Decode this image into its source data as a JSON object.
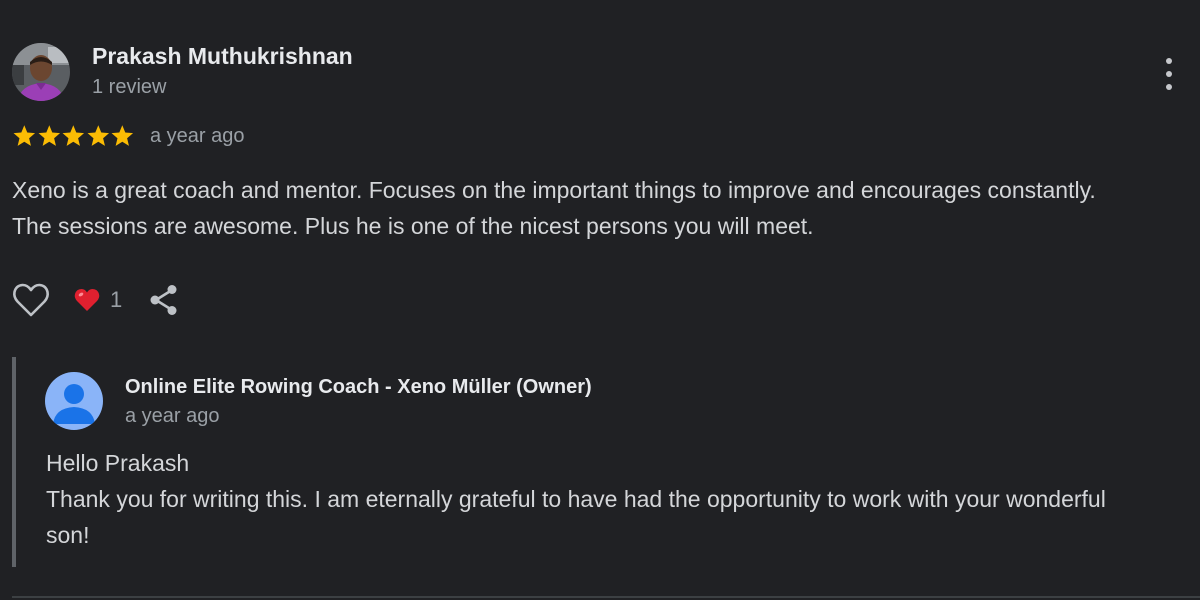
{
  "review": {
    "reviewer_name": "Prakash Muthukrishnan",
    "review_count": "1 review",
    "rating": 5,
    "rating_max": 5,
    "date": "a year ago",
    "text": "Xeno is a great coach and mentor. Focuses on the important things to improve and encourages constantly. The sessions are awesome. Plus he is one of the nicest persons you will meet.",
    "reaction_emoji": "❤️",
    "reaction_count": "1",
    "icons": {
      "more": "more-vert-icon",
      "like": "heart-outline-icon",
      "share": "share-icon",
      "star": "star-icon"
    },
    "star_color": "#fbbc04"
  },
  "owner_reply": {
    "name": "Online Elite Rowing Coach - Xeno Müller (Owner)",
    "date": "a year ago",
    "greeting": "Hello Prakash",
    "text": "Thank you for writing this. I am eternally grateful to have had the opportunity to work with your wonderful son!",
    "avatar_color": "#8ab4f8"
  },
  "colors": {
    "background": "#202124",
    "primary_text": "#e8eaed",
    "secondary_text": "#9aa0a6"
  }
}
